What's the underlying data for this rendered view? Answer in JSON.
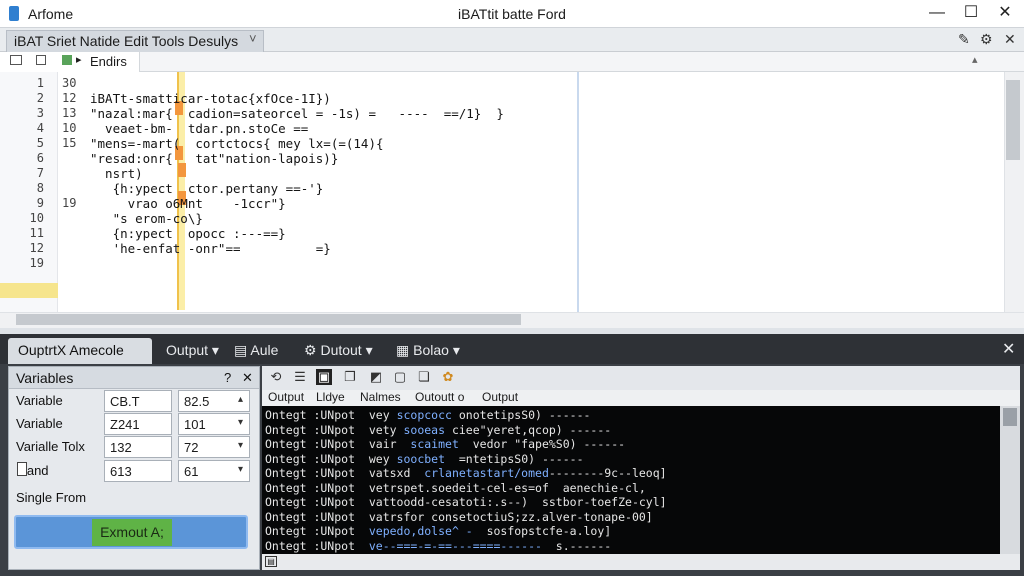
{
  "window": {
    "app_name": "Arfome",
    "title": "iBATtit batte Ford",
    "minimize": "—",
    "maximize": "☐",
    "close": "✕"
  },
  "menu": {
    "tab_text": "iBAT  Sriet Natide Edit Tools  Desulys",
    "tab_close": "˅",
    "right_icons": [
      "✎",
      "⚙",
      "✕"
    ]
  },
  "editor_tab": {
    "label": "Endirs",
    "caret": "▸"
  },
  "gutter_left": [
    "1",
    "2",
    "3",
    "4",
    "5",
    "6",
    "7",
    "8",
    "9",
    "10",
    "11",
    "12",
    "19"
  ],
  "gutter_right": [
    "30",
    "12",
    "13",
    "10",
    "15",
    "",
    "",
    "",
    "19",
    "",
    "",
    "",
    ""
  ],
  "code_lines": [
    "",
    "iBATt-smatticar-totac{xfOce-1I})",
    "\"nazal:mar{  cadion=sateorcel = -1s) =   ----  ==/1}  }",
    "  veaet-bm-  tdar.pn.stoCe ==",
    "\"mens=-mart(  cortctocs{ mey lx=(=(14){",
    "\"resad:onr{   tat\"nation-lapois)}",
    "  nsrt)",
    "   {h:ypect  ctor.pertany ==-'}",
    "     vrao o6Mnt    -1ccr\"}",
    "   \"s erom-co\\}",
    "   {n:ypect  opocc :---==}",
    "   'he-enfat -onr\"==          =}",
    ""
  ],
  "bottom_tabs": [
    "OuptrtX  Amecole",
    "Output",
    "Aule",
    "Dutout",
    "Bolao"
  ],
  "variables": {
    "header": "Variables",
    "help": "?",
    "close": "✕",
    "rows": [
      {
        "label": "Variable",
        "v1": "CB.T",
        "v2": "82.5"
      },
      {
        "label": "Variable",
        "v1": "Z241",
        "v2": "101"
      },
      {
        "label": "Varialle Tolx",
        "v1": "132",
        "v2": "72"
      },
      {
        "label": "1.and",
        "v1": "613",
        "v2": "61"
      }
    ],
    "single_from": "Single From",
    "export_label": "Exmout A;"
  },
  "output_tabs": [
    "Output",
    "Lldye",
    "Nalmes",
    "Outoutt o",
    "Output"
  ],
  "console_lines": [
    {
      "pre": "Ontegt :UNpot  vey ",
      "blue": "scopcocc",
      "post": " onotetipsS0) ------"
    },
    {
      "pre": "Ontegt :UNpot  vety ",
      "blue": "sooeas",
      "post": " ciee\"yeret,qcop) ------"
    },
    {
      "pre": "Ontegt :UNpot  vair  ",
      "blue": "scaimet",
      "post": "  vedor \"fape%S0) ------"
    },
    {
      "pre": "Ontegt :UNpot  wey ",
      "blue": "soocbet",
      "post": "  =ntetipsS0) ------"
    },
    {
      "pre": "Ontegt :UNpot  vatsxd  ",
      "blue": "crlanetastart/omed",
      "post": "--------9c--leoq]"
    },
    {
      "pre": "Ontegt :UNpot  vetrspet.soedeit-cel-es=of  aenechie-cl,",
      "blue": "",
      "post": ""
    },
    {
      "pre": "Ontegt :UNpot  vattoodd-cesatoti:.s--)  sstbor-toefZe-cyl]",
      "blue": "",
      "post": ""
    },
    {
      "pre": "Ontegt :UNpot  vatrsfor consetoctiuS;zz.alver-tonape-00]",
      "blue": "",
      "post": ""
    },
    {
      "pre": "Ontegt :UNpot  ",
      "blue": "vepedo,dolse^ -",
      "post": "  sosfopstcfe-a.loy]"
    },
    {
      "pre": "Ontegt :UNpot  ",
      "blue": "ve--===-=-==---====------",
      "post": "  s.------"
    }
  ],
  "colors": {
    "accent": "#5b95d8",
    "export_green": "#5fb346",
    "cursor_line": "#f6e58d"
  }
}
